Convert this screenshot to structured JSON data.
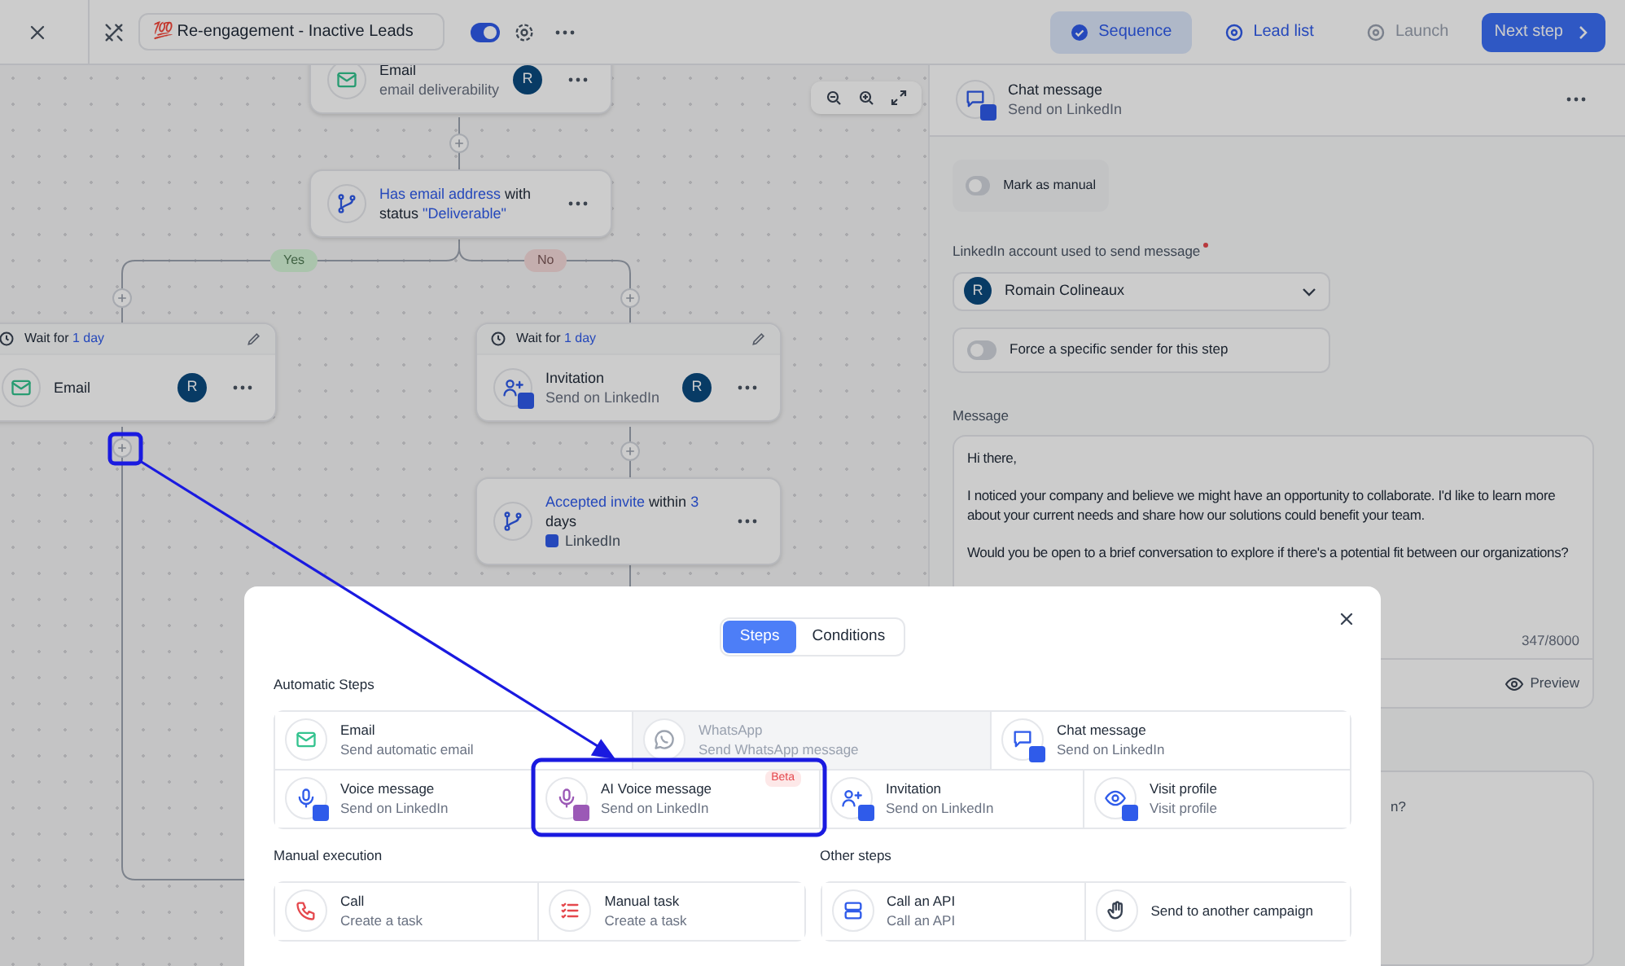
{
  "top_bar": {
    "campaign_name": "💯 Re-engagement - Inactive Leads",
    "active": true,
    "tabs": [
      {
        "label": "Sequence",
        "kind": "check",
        "selected": true,
        "disabled": false
      },
      {
        "label": "Lead list",
        "kind": "circle",
        "selected": false,
        "disabled": false
      },
      {
        "label": "Launch",
        "kind": "circle",
        "selected": false,
        "disabled": true
      }
    ],
    "next_button": "Next step"
  },
  "canvas": {
    "nodes": [
      {
        "kind": "email",
        "title": [
          {
            "text": "Email",
            "highlight": false
          }
        ],
        "subtitle": "email deliverability",
        "avatar": "R"
      },
      {
        "kind": "condition",
        "title": [
          {
            "text": "Has email address",
            "highlight": true
          },
          {
            "text": " with status ",
            "highlight": false
          },
          {
            "text": "\"Deliverable\"",
            "highlight": true
          }
        ]
      },
      {
        "kind": "email",
        "wait": [
          {
            "text": "Wait for ",
            "highlight": false
          },
          {
            "text": "1 day",
            "highlight": true
          }
        ],
        "title": [
          {
            "text": "Email",
            "highlight": false
          }
        ],
        "avatar": "R"
      },
      {
        "kind": "invite",
        "wait": [
          {
            "text": "Wait for ",
            "highlight": false
          },
          {
            "text": "1 day",
            "highlight": true
          }
        ],
        "title": [
          {
            "text": "Invitation",
            "highlight": false
          }
        ],
        "subtitle": "Send on LinkedIn",
        "avatar": "R"
      },
      {
        "kind": "condition",
        "title": [
          {
            "text": "Accepted invite",
            "highlight": true
          },
          {
            "text": " within ",
            "highlight": false
          },
          {
            "text": "3",
            "highlight": true
          },
          {
            "text": " days",
            "highlight": false
          }
        ],
        "channel": "LinkedIn"
      }
    ],
    "branches": [
      {
        "label": "Yes",
        "color": "#aac4ad"
      },
      {
        "label": "No",
        "color": "#c4aeae"
      }
    ]
  },
  "right_panel": {
    "step_title": "Chat message",
    "step_subtitle": "Send on LinkedIn",
    "mark_manual": {
      "label": "Mark as manual",
      "on": false
    },
    "account_label": "LinkedIn account used to send message",
    "required": true,
    "account": {
      "avatar": "R",
      "name": "Romain Colineaux"
    },
    "force_sender": {
      "label": "Force a specific sender for this step",
      "on": false
    },
    "message_label": "Message",
    "message": "Hi there,\n\nI noticed your company and believe we might have an opportunity to collaborate. I'd like to learn more about your current needs and share how our solutions could benefit your team.\n\nWould you be open to a brief conversation to explore if there's a potential fit between our organizations?",
    "counter": "347/8000",
    "preview": "Preview",
    "next_box_text": "n?"
  },
  "modal": {
    "tabs": [
      {
        "label": "Steps",
        "selected": true
      },
      {
        "label": "Conditions",
        "selected": false
      }
    ],
    "sections": [
      {
        "title": "Automatic Steps",
        "rows": [
          [
            {
              "kind": "email",
              "title": "Email",
              "subtitle": "Send automatic email",
              "disabled": false,
              "linkedin": false
            },
            {
              "kind": "whatsapp",
              "title": "WhatsApp",
              "subtitle": "Send WhatsApp message",
              "disabled": true,
              "linkedin": false
            },
            {
              "kind": "chat",
              "title": "Chat message",
              "subtitle": "Send on LinkedIn",
              "disabled": false,
              "linkedin": true
            }
          ],
          [
            {
              "kind": "voice",
              "title": "Voice message",
              "subtitle": "Send on LinkedIn",
              "disabled": false,
              "linkedin": true
            },
            {
              "kind": "ai_voice",
              "title": "AI Voice message",
              "subtitle": "Send on LinkedIn",
              "disabled": false,
              "linkedin": true,
              "badge": "Beta"
            },
            {
              "kind": "invite",
              "title": "Invitation",
              "subtitle": "Send on LinkedIn",
              "disabled": false,
              "linkedin": true
            },
            {
              "kind": "visit",
              "title": "Visit profile",
              "subtitle": "Visit profile",
              "disabled": false,
              "linkedin": true
            }
          ]
        ]
      },
      {
        "title": "Manual execution",
        "rows": [
          [
            {
              "kind": "call",
              "title": "Call",
              "subtitle": "Create a task",
              "disabled": false,
              "linkedin": false
            },
            {
              "kind": "task",
              "title": "Manual task",
              "subtitle": "Create a task",
              "disabled": false,
              "linkedin": false
            }
          ]
        ]
      },
      {
        "title": "Other steps",
        "rows": [
          [
            {
              "kind": "api",
              "title": "Call an API",
              "subtitle": "Call an API",
              "disabled": false,
              "linkedin": false
            },
            {
              "kind": "campaign",
              "title": "Send to another campaign",
              "disabled": false,
              "linkedin": false
            }
          ]
        ]
      }
    ]
  }
}
